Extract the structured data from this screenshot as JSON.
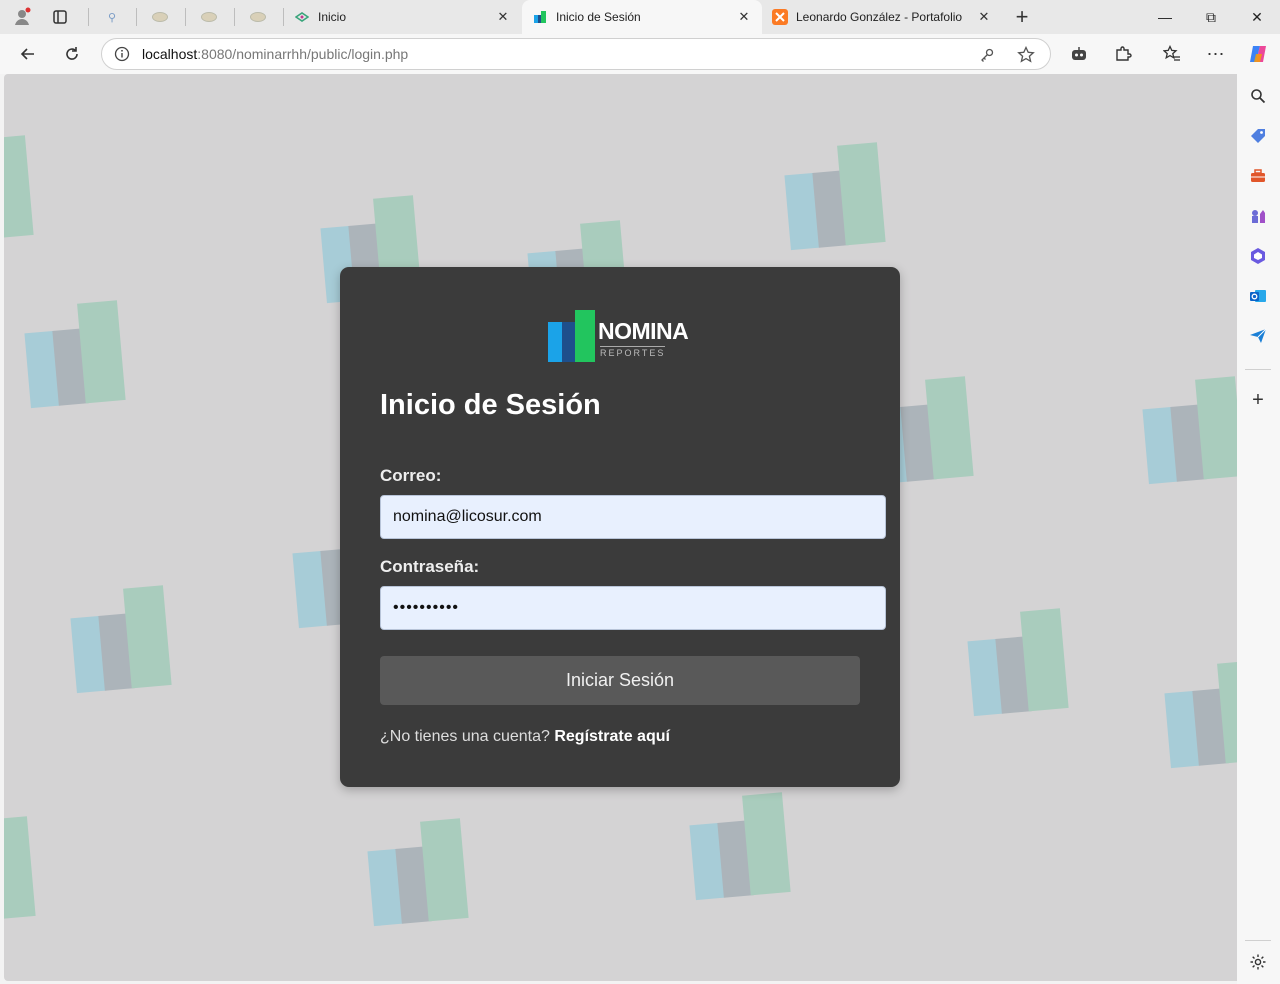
{
  "browser": {
    "tabs": [
      {
        "title": "Inicio",
        "active": false
      },
      {
        "title": "Inicio de Sesión",
        "active": true
      },
      {
        "title": "Leonardo González - Portafolio",
        "active": false
      }
    ],
    "url_host": "localhost",
    "url_path": ":8080/nominarrhh/public/login.php"
  },
  "logo": {
    "word": "NOMINA",
    "sub": "REPORTES"
  },
  "form": {
    "title": "Inicio de Sesión",
    "email_label": "Correo:",
    "email_value": "nomina@licosur.com",
    "password_label": "Contraseña:",
    "password_value": "••••••••••",
    "submit_label": "Iniciar Sesión",
    "signup_prompt": "¿No tienes una cuenta?",
    "signup_link": "Regístrate aquí"
  },
  "colors": {
    "card": "#3b3b3b",
    "button": "#595959",
    "background": "#d4d3d4",
    "logo_blue": "#1ba3e8",
    "logo_green": "#22c55e"
  }
}
